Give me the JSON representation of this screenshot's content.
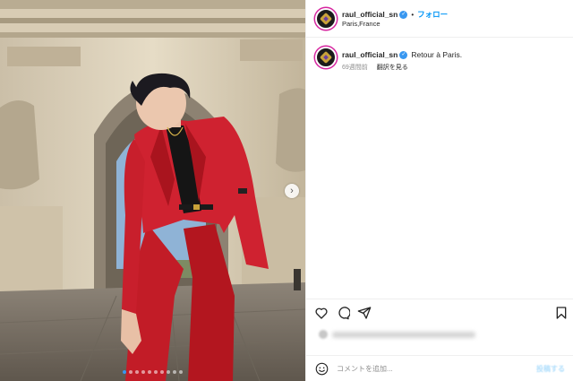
{
  "post": {
    "username": "raul_official_sn",
    "follow_label": "フォロー",
    "separator": "•",
    "location": "Paris,France",
    "caption_text": "Retour à Paris.",
    "time_ago": "69週間前",
    "translate_label": "翻訳を見る",
    "image_count": 10,
    "active_image_index": 0
  },
  "actions": {
    "like_icon": "heart-icon",
    "comment_icon": "comment-icon",
    "share_icon": "share-icon",
    "save_icon": "bookmark-icon"
  },
  "comment": {
    "placeholder": "コメントを追加...",
    "post_label": "投稿する"
  },
  "colors": {
    "accent": "#0095f6",
    "verified": "#3897f0",
    "suit": "#c8202b"
  }
}
